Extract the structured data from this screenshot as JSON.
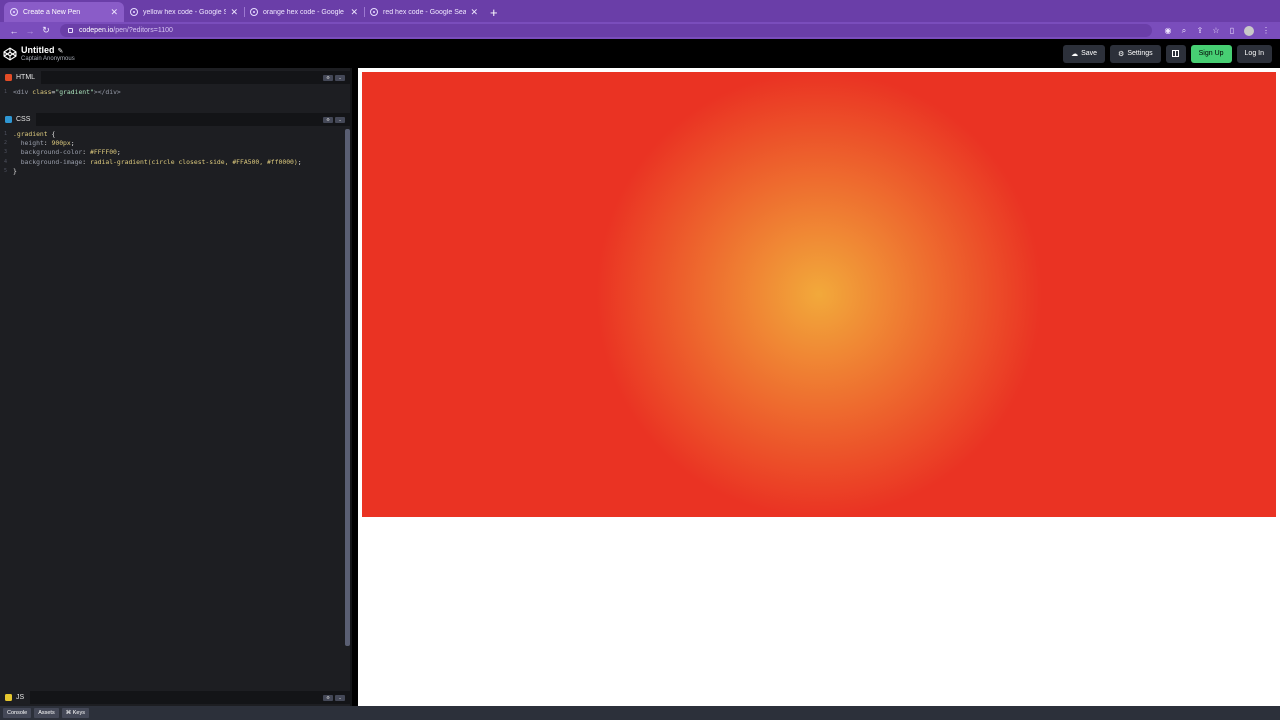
{
  "browser": {
    "tabs": [
      {
        "label": "Create a New Pen",
        "active": true
      },
      {
        "label": "yellow hex code - Google Sea",
        "active": false
      },
      {
        "label": "orange hex code - Google Sea",
        "active": false
      },
      {
        "label": "red hex code - Google Search",
        "active": false
      }
    ],
    "new_tab_icon": "plus-icon",
    "url_host": "codepen.io",
    "url_path": "/pen/?editors=1100"
  },
  "header": {
    "title": "Untitled",
    "author": "Captain Anonymous",
    "save_label": "Save",
    "settings_label": "Settings",
    "signup_label": "Sign Up",
    "login_label": "Log In"
  },
  "editors": {
    "html": {
      "label": "HTML",
      "badge": "HTML",
      "lines": [
        {
          "n": "1",
          "tag_open": "<div ",
          "attr": "class",
          "eq": "=",
          "str": "\"gradient\"",
          "tag_close": "></div>"
        }
      ]
    },
    "css": {
      "label": "CSS",
      "lines": [
        {
          "n": "1",
          "sel": ".gradient",
          "rest": " {"
        },
        {
          "n": "2",
          "prop": "height",
          "colon": ": ",
          "val": "900px",
          "end": ";"
        },
        {
          "n": "3",
          "prop": "background-color",
          "colon": ": ",
          "val": "#FFFF00",
          "end": ";"
        },
        {
          "n": "4",
          "prop": "background-image",
          "colon": ": ",
          "val": "radial-gradient(circle closest-side, #FFA500, #ff0000)",
          "end": ";"
        },
        {
          "n": "5",
          "brace": "}"
        }
      ]
    },
    "js": {
      "label": "JS"
    }
  },
  "preview": {
    "gradient_center": "#f2a93b",
    "gradient_edge": "#ea3323"
  },
  "bottom": {
    "console_label": "Console",
    "assets_label": "Assets",
    "keys_label": "⌘ Keys"
  },
  "colors": {
    "browser_tab_bar": "#6a3ea8",
    "signup_green": "#47cf73",
    "editor_bg": "#1d1e22"
  }
}
